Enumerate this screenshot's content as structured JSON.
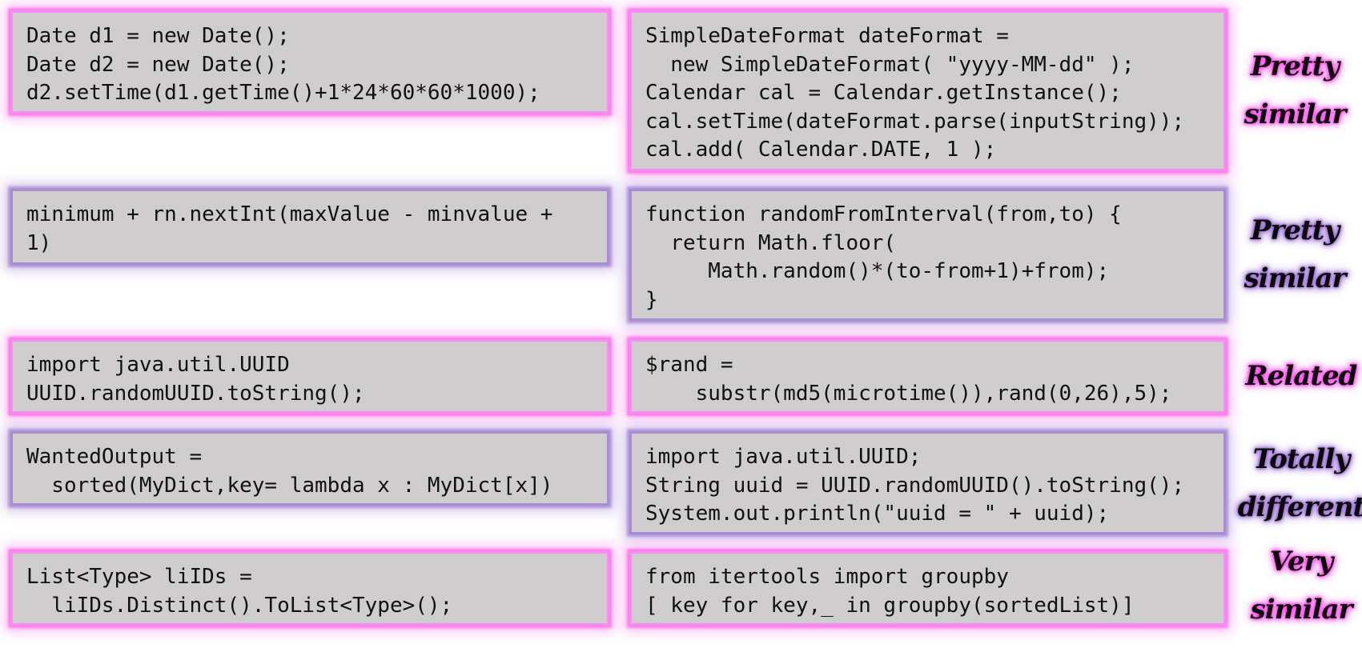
{
  "rows": [
    {
      "left": [
        "Date d1 = new Date();",
        "Date d2 = new Date();",
        "d2.setTime(d1.getTime()+1*24*60*60*1000);"
      ],
      "right": [
        "SimpleDateFormat dateFormat =",
        "  new SimpleDateFormat( \"yyyy-MM-dd\" );",
        "Calendar cal = Calendar.getInstance();",
        "cal.setTime(dateFormat.parse(inputString));",
        "cal.add( Calendar.DATE, 1 );"
      ],
      "verdict": [
        "Pretty",
        "similar"
      ],
      "glow": "pink"
    },
    {
      "left": [
        "minimum + rn.nextInt(maxValue - minvalue +",
        "1)"
      ],
      "right": [
        "function randomFromInterval(from,to) {",
        "  return Math.floor(",
        "     Math.random()*(to-from+1)+from);",
        "}"
      ],
      "verdict": [
        "Pretty",
        "similar"
      ],
      "glow": "purple"
    },
    {
      "left": [
        "import java.util.UUID",
        "UUID.randomUUID.toString();"
      ],
      "right": [
        "$rand =",
        "    substr(md5(microtime()),rand(0,26),5);"
      ],
      "verdict": [
        "Related"
      ],
      "glow": "pink"
    },
    {
      "left": [
        "WantedOutput =",
        "  sorted(MyDict,key= lambda x : MyDict[x])"
      ],
      "right": [
        "import java.util.UUID;",
        "String uuid = UUID.randomUUID().toString();",
        "System.out.println(\"uuid = \" + uuid);"
      ],
      "verdict": [
        "Totally",
        "different"
      ],
      "glow": "purple"
    },
    {
      "left": [
        "List<Type> liIDs =",
        "  liIDs.Distinct().ToList<Type>();"
      ],
      "right": [
        "from itertools import groupby",
        "[ key for key,_ in groupby(sortedList)]"
      ],
      "verdict": [
        "Very",
        "similar"
      ],
      "glow": "pink"
    }
  ]
}
